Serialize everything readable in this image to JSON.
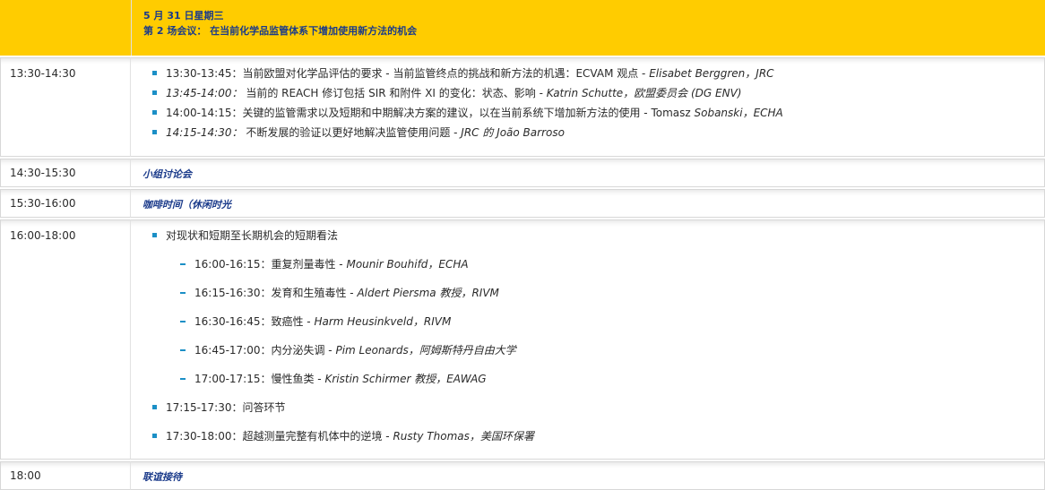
{
  "header": {
    "date": "5 月 31 日星期三",
    "session": "第 2 场会议： 在当前化学品监管体系下增加使用新方法的机会"
  },
  "rows": [
    {
      "time": "13:30-14:30",
      "items": [
        {
          "plain": "13:30-13:45：当前欧盟对化学品评估的要求 - 当前监管终点的挑战和新方法的机遇：ECVAM 观点 - ",
          "ital": " Elisabet Berggren，JRC"
        },
        {
          "ital_prefix": "13:45-14:00：",
          "plain": " 当前的 REACH 修订包括 SIR 和附件 XI 的变化：状态、影响 - ",
          "ital": " Katrin Schutte，欧盟委员会 (DG ENV)"
        },
        {
          "plain": "14:00-14:15：关键的监管需求以及短期和中期解决方案的建议，以在当前系统下增加新方法的使用 - Tomasz ",
          "ital": " Sobanski，ECHA"
        },
        {
          "ital_prefix": "14:15-14:30：",
          "plain": " 不断发展的验证以更好地解决监管使用问题 - ",
          "ital": " JRC 的 João Barroso"
        }
      ]
    },
    {
      "time": "14:30-15:30",
      "title": "小组讨论会"
    },
    {
      "time": "15:30-16:00",
      "title": "咖啡时间（休闲时光"
    },
    {
      "time": "16:00-18:00",
      "intro": "对现状和短期至长期机会的短期看法",
      "subitems": [
        {
          "plain": "16:00-16:15：重复剂量毒性 - ",
          "ital": " Mounir Bouhifd，ECHA"
        },
        {
          "plain": "16:15-16:30：发育和生殖毒性 - ",
          "ital": " Aldert Piersma 教授，RIVM"
        },
        {
          "plain": "16:30-16:45：致癌性 - ",
          "ital": " Harm Heusinkveld，RIVM"
        },
        {
          "plain": "16:45-17:00：内分泌失调 - ",
          "ital": " Pim Leonards，阿姆斯特丹自由大学"
        },
        {
          "plain": "17:00-17:15：慢性鱼类 - ",
          "ital": " Kristin Schirmer 教授，EAWAG"
        }
      ],
      "after": [
        {
          "plain": "17:15-17:30：问答环节"
        },
        {
          "plain": "17:30-18:00：超越测量完整有机体中的逆境 - ",
          "ital": " Rusty Thomas，美国环保署"
        }
      ]
    },
    {
      "time": "18:00",
      "title": "联谊接待"
    }
  ]
}
